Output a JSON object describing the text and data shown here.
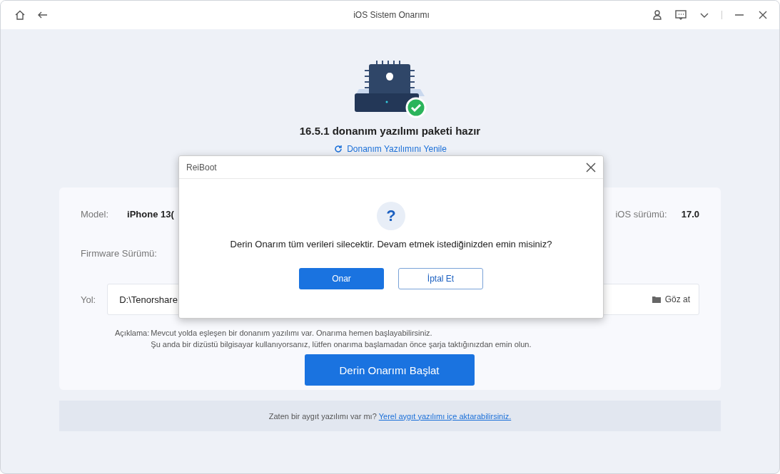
{
  "window": {
    "title": "iOS Sistem Onarımı"
  },
  "hero": {
    "title": "16.5.1 donanım yazılımı paketi hazır",
    "refresh_link": "Donanım Yazılımını Yenile"
  },
  "device": {
    "model_label": "Model:",
    "model_value": "iPhone 13(",
    "ios_label": "iOS sürümü:",
    "ios_value": "17.0",
    "firmware_label": "Firmware Sürümü:"
  },
  "path": {
    "label": "Yol:",
    "value": "D:\\Tenorshare",
    "browse": "Göz at"
  },
  "description": {
    "label": "Açıklama:",
    "lines": [
      "Mevcut yolda eşleşen bir donanım yazılımı var. Onarıma hemen başlayabilirsiniz.",
      "Şu anda bir dizüstü bilgisayar kullanıyorsanız, lütfen onarıma başlamadan önce şarja taktığınızdan emin olun."
    ]
  },
  "start_button": "Derin Onarımı Başlat",
  "footer": {
    "text": "Zaten bir aygıt yazılımı var mı?",
    "link": "Yerel aygıt yazılımı içe aktarabilirsiniz."
  },
  "dialog": {
    "title": "ReiBoot",
    "icon": "?",
    "message": "Derin Onarım tüm verileri silecektir. Devam etmek istediğinizden emin misiniz?",
    "buttons": [
      {
        "label": "Onar",
        "kind": "primary"
      },
      {
        "label": "İptal Et",
        "kind": "secondary"
      }
    ]
  }
}
